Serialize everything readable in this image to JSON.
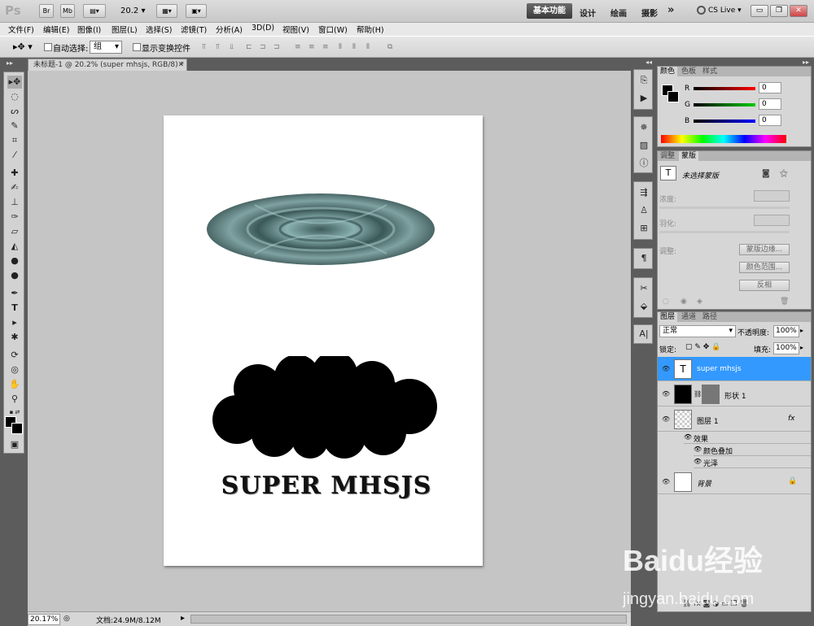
{
  "app": {
    "logo": "Ps",
    "zoom_value": "20.2",
    "workspaces": [
      "基本功能",
      "设计",
      "绘画",
      "摄影"
    ],
    "more": "»",
    "cs_live": "CS Live"
  },
  "menu": [
    "文件(F)",
    "编辑(E)",
    "图像(I)",
    "图层(L)",
    "选择(S)",
    "滤镜(T)",
    "分析(A)",
    "3D(D)",
    "视图(V)",
    "窗口(W)",
    "帮助(H)"
  ],
  "options": {
    "auto_select": "自动选择:",
    "group_value": "组",
    "show_transform": "显示变换控件"
  },
  "document": {
    "tab_title": "未标题-1 @ 20.2% (super mhsjs, RGB/8) *",
    "text": "SUPER MHSJS"
  },
  "status": {
    "zoom": "20.17%",
    "doc_info": "文档:24.9M/8.12M"
  },
  "color_panel": {
    "tabs": [
      "颜色",
      "色板",
      "样式"
    ],
    "channels": [
      {
        "label": "R",
        "value": "0"
      },
      {
        "label": "G",
        "value": "0"
      },
      {
        "label": "B",
        "value": "0"
      }
    ]
  },
  "mask_panel": {
    "tabs": [
      "调整",
      "蒙版"
    ],
    "title": "未选择蒙版",
    "density": "浓度:",
    "feather": "羽化:",
    "refine": "调整:",
    "buttons": [
      "蒙版边缘...",
      "颜色范围...",
      "反相"
    ]
  },
  "layers_panel": {
    "tabs": [
      "图层",
      "通道",
      "路径"
    ],
    "blend_mode": "正常",
    "opacity_label": "不透明度:",
    "opacity": "100%",
    "lock_label": "锁定:",
    "fill_label": "填充:",
    "fill": "100%",
    "layers": [
      {
        "name": "super mhsjs"
      },
      {
        "name": "形状 1"
      },
      {
        "name": "图层 1",
        "fx": "fx"
      },
      {
        "name": "背景"
      }
    ],
    "effects_label": "效果",
    "effects": [
      "颜色叠加",
      "光泽"
    ]
  },
  "watermark": {
    "line1": "Baidu经验",
    "line2": "jingyan.baidu.com"
  },
  "colors": {
    "selection": "#3399ff",
    "chrome_dark": "#5c5c5c",
    "ellipse": "#4f6b6b"
  }
}
